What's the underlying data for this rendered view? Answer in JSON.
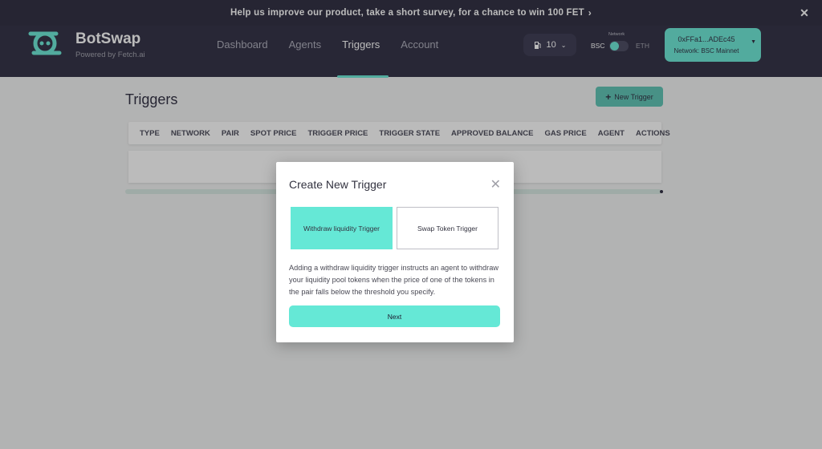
{
  "banner": {
    "text": "Help us improve our product, take a short survey, for a chance to win 100 FET",
    "close": "✕"
  },
  "brand": {
    "name": "BotSwap",
    "tagline": "Powered by Fetch.ai"
  },
  "nav": [
    "Dashboard",
    "Agents",
    "Triggers",
    "Account"
  ],
  "nav_active": "Triggers",
  "gas": {
    "value": "10"
  },
  "network": {
    "label": "Network",
    "left": "BSC",
    "right": "ETH"
  },
  "wallet": {
    "address": "0xFFa1...ADEc45",
    "network": "Network: BSC Mainnet"
  },
  "page": {
    "title": "Triggers",
    "new_button": "New Trigger"
  },
  "table": {
    "columns": [
      "TYPE",
      "NETWORK",
      "PAIR",
      "SPOT PRICE",
      "TRIGGER PRICE",
      "TRIGGER STATE",
      "APPROVED BALANCE",
      "GAS PRICE",
      "AGENT",
      "ACTIONS"
    ]
  },
  "modal": {
    "title": "Create New Trigger",
    "options": [
      "Withdraw liquidity Trigger",
      "Swap Token Trigger"
    ],
    "description": "Adding a withdraw liquidity trigger instructs an agent to withdraw your liquidity pool tokens when the price of one of the tokens in the pair falls below the threshold you specify.",
    "next": "Next"
  },
  "colors": {
    "accent": "#65e8d6",
    "header": "#1e1d33",
    "banner": "#1b1a2e"
  }
}
